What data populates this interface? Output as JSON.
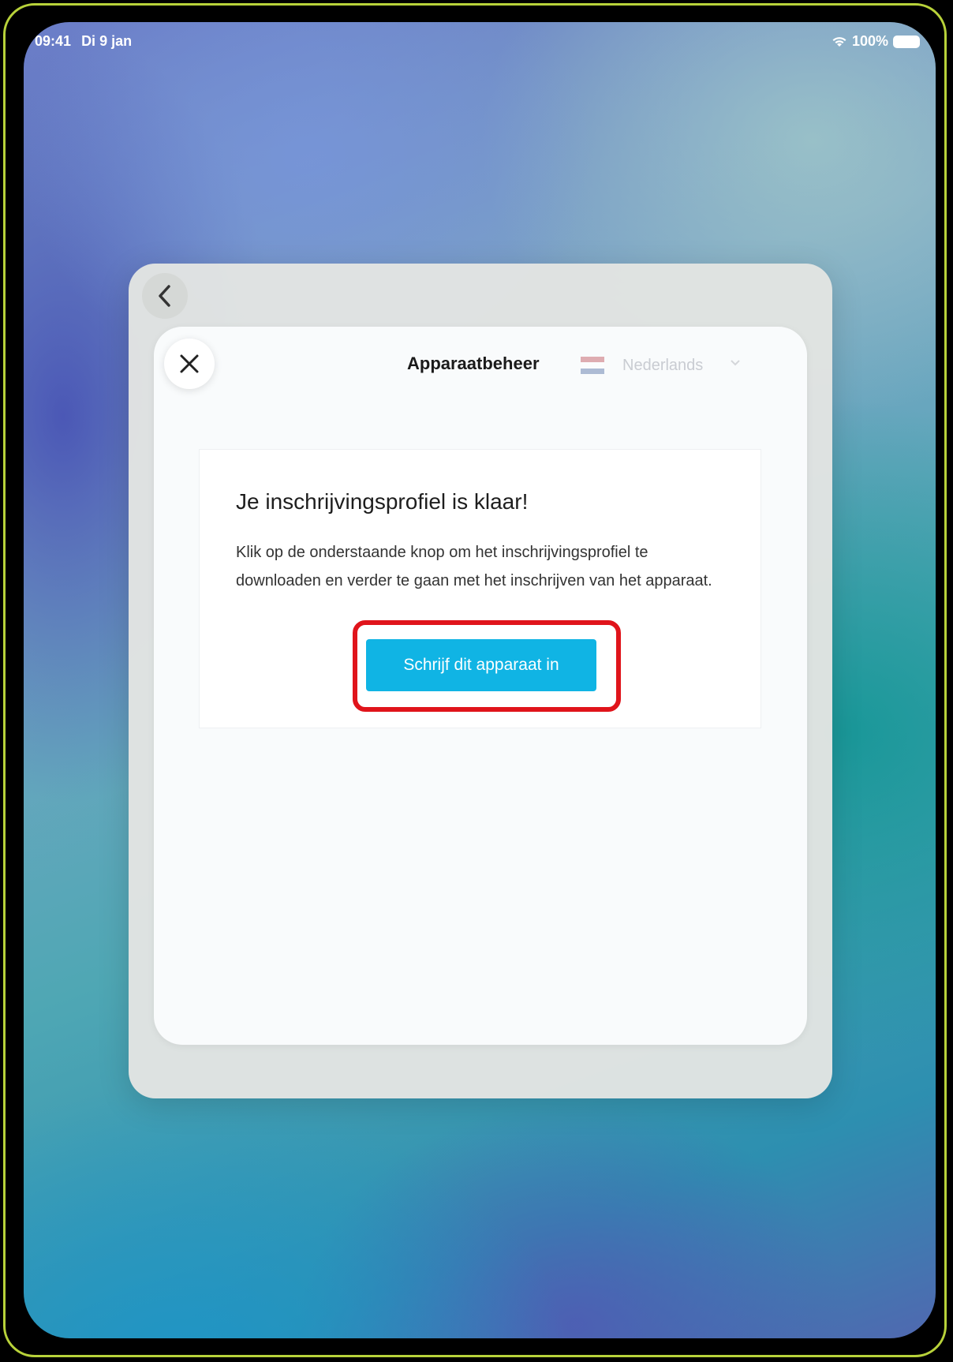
{
  "status_bar": {
    "time": "09:41",
    "date": "Di 9 jan",
    "battery": "100%"
  },
  "sheet": {
    "header_title": "Apparaatbeheer",
    "language_label": "Nederlands"
  },
  "card": {
    "heading": "Je inschrijvingsprofiel is klaar!",
    "body": "Klik op de onderstaande knop om het inschrijvingsprofiel te downloaden en verder te gaan met het inschrijven van het apparaat.",
    "enroll_button_label": "Schrijf dit apparaat in"
  },
  "colors": {
    "accent_button": "#10b4e4",
    "highlight_border": "#e0141b"
  },
  "icons": {
    "back": "chevron-left-icon",
    "close": "close-icon",
    "wifi": "wifi-icon",
    "battery": "battery-icon",
    "flag": "netherlands-flag-icon",
    "dropdown": "chevron-down-icon"
  }
}
